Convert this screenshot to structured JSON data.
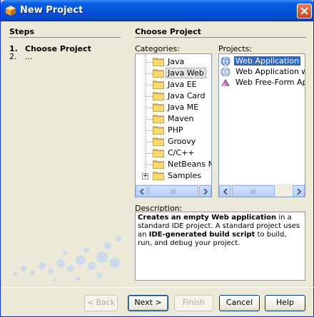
{
  "window": {
    "title": "New Project"
  },
  "steps": {
    "title": "Steps",
    "items": [
      {
        "num": "1.",
        "label": "Choose Project"
      },
      {
        "num": "2.",
        "label": "..."
      }
    ]
  },
  "panel": {
    "title": "Choose Project",
    "categories_label": "Categories:",
    "projects_label": "Projects:",
    "categories": [
      "Java",
      "Java Web",
      "Java EE",
      "Java Card",
      "Java ME",
      "Maven",
      "PHP",
      "Groovy",
      "C/C++",
      "NetBeans Modu",
      "Samples"
    ],
    "selected_category": "Java Web",
    "projects": [
      "Web Application",
      "Web Application with E:",
      "Web Free-Form Applica"
    ],
    "selected_project": "Web Application",
    "description_label": "Description:",
    "description": {
      "p1_bold": "Creates an empty Web application",
      "p1_rest": " in a standard IDE project. A standard project uses an ",
      "p2_bold": "IDE-generated build script",
      "p2_rest": " to build, run, and debug your project."
    }
  },
  "buttons": {
    "back": "< Back",
    "next": "Next >",
    "finish": "Finish",
    "cancel": "Cancel",
    "help": "Help"
  },
  "colors": {
    "titlebar": "#0553da",
    "selection": "#316ac5",
    "dialog_bg": "#ece9d8"
  }
}
